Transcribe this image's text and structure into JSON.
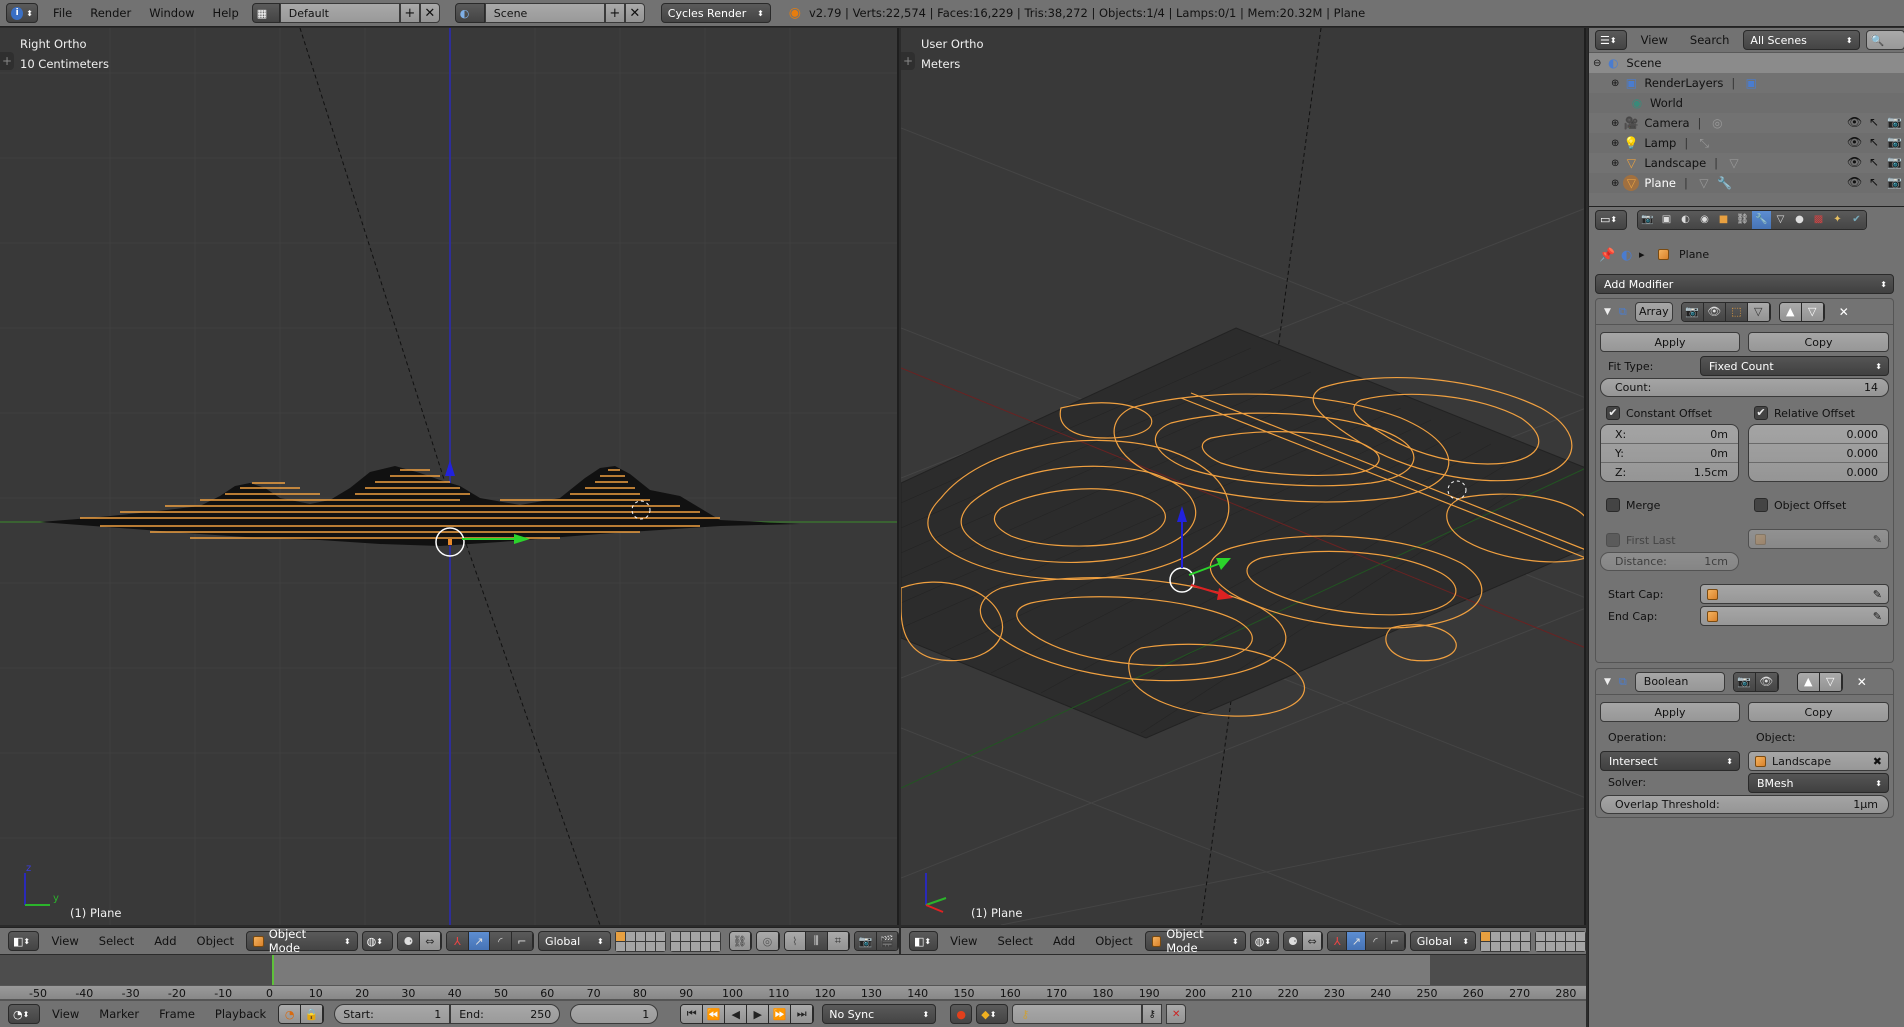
{
  "topbar": {
    "menus": [
      "File",
      "Render",
      "Window",
      "Help"
    ],
    "screen_layout": "Default",
    "scene": "Scene",
    "render_engine": "Cycles Render",
    "stats": "v2.79 | Verts:22,574 | Faces:16,229 | Tris:38,272 | Objects:1/4 | Lamps:0/1 | Mem:20.32M | Plane"
  },
  "viewport_left": {
    "view_name": "Right Ortho",
    "scale": "10 Centimeters",
    "object_label": "(1) Plane",
    "axis_labels": {
      "up": "z",
      "right": "y"
    },
    "header": {
      "menus": [
        "View",
        "Select",
        "Add",
        "Object"
      ],
      "mode": "Object Mode",
      "orientation": "Global"
    }
  },
  "viewport_right": {
    "view_name": "User Ortho",
    "scale": "Meters",
    "object_label": "(1) Plane",
    "header": {
      "menus": [
        "View",
        "Select",
        "Add",
        "Object"
      ],
      "mode": "Object Mode",
      "orientation": "Global"
    }
  },
  "outliner": {
    "header": {
      "view": "View",
      "search": "Search",
      "filter": "All Scenes"
    },
    "items": [
      {
        "label": "Scene",
        "icon": "scene-icon",
        "level": 0,
        "selected": true
      },
      {
        "label": "RenderLayers",
        "icon": "render-layers-icon",
        "level": 1
      },
      {
        "label": "World",
        "icon": "world-icon",
        "level": 1
      },
      {
        "label": "Camera",
        "icon": "camera-icon",
        "level": 1
      },
      {
        "label": "Lamp",
        "icon": "lamp-icon",
        "level": 1
      },
      {
        "label": "Landscape",
        "icon": "mesh-icon",
        "level": 1
      },
      {
        "label": "Plane",
        "icon": "mesh-icon",
        "level": 1,
        "active": true
      }
    ]
  },
  "properties": {
    "breadcrumb_object": "Plane",
    "add_modifier": "Add Modifier",
    "array": {
      "name": "Array",
      "apply": "Apply",
      "copy": "Copy",
      "fit_type_label": "Fit Type:",
      "fit_type": "Fixed Count",
      "count_label": "Count:",
      "count": "14",
      "constant_offset_label": "Constant Offset",
      "constant_offset": true,
      "relative_offset_label": "Relative Offset",
      "relative_offset": true,
      "constant": [
        {
          "label": "X:",
          "value": "0m"
        },
        {
          "label": "Y:",
          "value": "0m"
        },
        {
          "label": "Z:",
          "value": "1.5cm"
        }
      ],
      "relative": [
        "0.000",
        "0.000",
        "0.000"
      ],
      "merge_label": "Merge",
      "merge": false,
      "object_offset_label": "Object Offset",
      "object_offset": false,
      "first_last_label": "First Last",
      "distance_label": "Distance:",
      "distance": "1cm",
      "start_cap_label": "Start Cap:",
      "end_cap_label": "End Cap:"
    },
    "boolean": {
      "name": "Boolean",
      "apply": "Apply",
      "copy": "Copy",
      "operation_label": "Operation:",
      "operation": "Intersect",
      "object_label": "Object:",
      "object": "Landscape",
      "solver_label": "Solver:",
      "solver": "BMesh",
      "overlap_label": "Overlap Threshold:",
      "overlap": "1µm"
    }
  },
  "timeline": {
    "ticks": [
      "-50",
      "-40",
      "-30",
      "-20",
      "-10",
      "0",
      "10",
      "20",
      "30",
      "40",
      "50",
      "60",
      "70",
      "80",
      "90",
      "100",
      "110",
      "120",
      "130",
      "140",
      "150",
      "160",
      "170",
      "180",
      "190",
      "200",
      "210",
      "220",
      "230",
      "240",
      "250",
      "260",
      "270",
      "280"
    ],
    "menus": [
      "View",
      "Marker",
      "Frame",
      "Playback"
    ],
    "start_label": "Start:",
    "start": "1",
    "end_label": "End:",
    "end": "250",
    "current_frame": "1",
    "sync": "No Sync"
  }
}
